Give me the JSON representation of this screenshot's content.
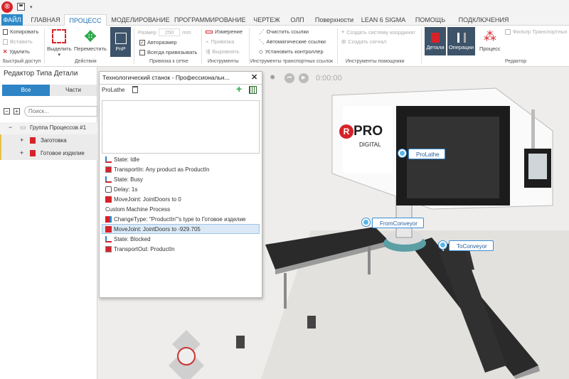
{
  "app": {
    "title": ""
  },
  "tabs": [
    "ФАЙЛ",
    "ГЛАВНАЯ",
    "ПРОЦЕСС",
    "МОДЕЛИРОВАНИЕ",
    "ПРОГРАММИРОВАНИЕ",
    "ЧЕРТЕЖ",
    "ОЛП",
    "Поверхности",
    "LEAN 6 SIGMA",
    "ПОМОЩЬ",
    "ПОДКЛЮЧЕНИЯ"
  ],
  "ribbon": {
    "clipboard": {
      "copy": "Копировать",
      "paste": "Вставить",
      "delete": "Удалить",
      "label": "Быстрый доступ"
    },
    "actions": {
      "select": "Выделить",
      "move": "Переместить",
      "pnp": "PnP",
      "label": "Действия"
    },
    "grid": {
      "size_label": "Размер",
      "size_value": "250",
      "size_unit": "mm",
      "autosize": "Авторазмер",
      "always_snap": "Всегда привязывать",
      "label": "Привязка к сетке"
    },
    "tools": {
      "measure": "Измерение",
      "snap": "Привязка",
      "align": "Выровнять",
      "label": "Инструменты"
    },
    "transport": {
      "clear": "Очистить ссылки",
      "auto": "Автоматические ссылки",
      "controller": "Установить контроллер",
      "label": "Инструменты транспортных ссылок"
    },
    "helpers": {
      "coord": "Создать систему координат",
      "signal": "Создать сигнал",
      "label": "Инструменты помощники"
    },
    "editor": {
      "details": "Детали",
      "operations": "Операции",
      "process": "Процесс",
      "filter": "Фильтр Транспортных",
      "label": "Редактор"
    }
  },
  "left_panel": {
    "title": "Редактор Типа Детали",
    "tab_all": "Все",
    "tab_parts": "Части",
    "search_placeholder": "Поиск...",
    "tree": [
      {
        "label": "Группа Процессов #1"
      },
      {
        "label": "Заготовка"
      },
      {
        "label": "Готовое изделие"
      }
    ]
  },
  "dialog": {
    "title": "Технологический станок - Профессиональн...",
    "tab": "ProLathe",
    "statements": [
      "State: Idle",
      "TransportIn: Any product as ProductIn",
      "State: Busy",
      "Delay: 1s",
      "MoveJoint: JointDoors to 0",
      "Custom Machine Process",
      "ChangeType: \"ProductIn\"'s type to Готовое изделие",
      "MoveJoint: JointDoors to -929.705",
      "State: Blocked",
      "TransportOut: ProductIn"
    ]
  },
  "viewport": {
    "timer": "0:00:00",
    "brand": "PRO",
    "brand_sub": "DIGITAL",
    "callouts": {
      "prolathe": "ProLathe",
      "from": "FromConveyor",
      "to": "ToConveyor"
    }
  }
}
